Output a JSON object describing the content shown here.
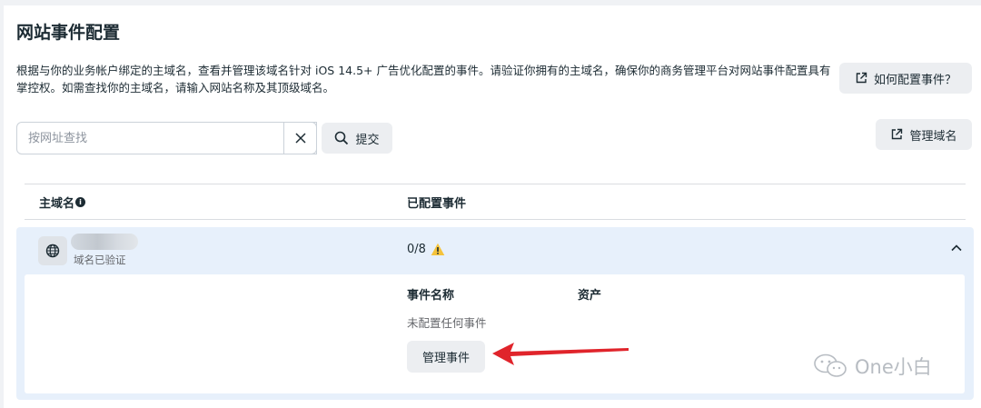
{
  "page": {
    "title": "网站事件配置",
    "description": "根据与你的业务帐户绑定的主域名，查看并管理该域名针对 iOS 14.5+ 广告优化配置的事件。请验证你拥有的主域名，确保你的商务管理平台对网站事件配置具有掌控权。如需查找你的主域名，请输入网站名称及其顶级域名。",
    "how_to_button": "如何配置事件？",
    "manage_domain_button": "管理域名"
  },
  "search": {
    "placeholder": "按网址查找",
    "value": "",
    "submit_label": "提交"
  },
  "table": {
    "headers": [
      "主域名",
      "已配置事件"
    ],
    "rows": [
      {
        "domain_status": "域名已验证",
        "configured_events": "0/8",
        "warning": true,
        "expanded": true,
        "details": {
          "headers": [
            "事件名称",
            "资产"
          ],
          "empty_text": "未配置任何事件",
          "manage_events_button": "管理事件"
        }
      }
    ]
  },
  "watermark": {
    "text": "One小白"
  },
  "colors": {
    "row_highlight": "#e7f0fb",
    "button_bg": "#eceef1",
    "warning": "#f5c33b",
    "arrow": "#e0242b"
  },
  "icons": {
    "external": "external-link-icon",
    "search": "search-icon",
    "clear": "close-icon",
    "globe": "globe-icon",
    "warning": "warning-icon",
    "chevron": "chevron-up-icon"
  }
}
